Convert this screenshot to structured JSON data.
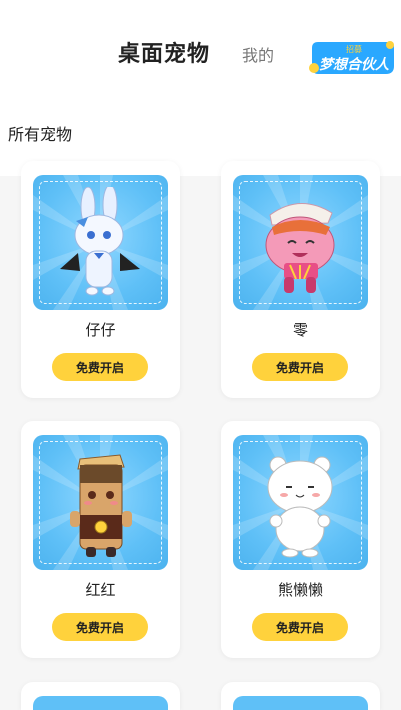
{
  "header": {
    "tab_active": "桌面宠物",
    "tab_mine": "我的",
    "promo": {
      "small": "招募",
      "big": "梦想合伙人",
      "colors": [
        "#2aa8ff",
        "#ffd23c"
      ]
    }
  },
  "section_title": "所有宠物",
  "accent_color": "#ffd23c",
  "pets": [
    {
      "name": "仔仔",
      "button": "免费开启",
      "icon": "bunny-pet-icon"
    },
    {
      "name": "零",
      "button": "免费开启",
      "icon": "pink-pig-pet-icon"
    },
    {
      "name": "红红",
      "button": "免费开启",
      "icon": "brown-bar-pet-icon"
    },
    {
      "name": "熊懒懒",
      "button": "免费开启",
      "icon": "white-bear-pet-icon"
    }
  ]
}
